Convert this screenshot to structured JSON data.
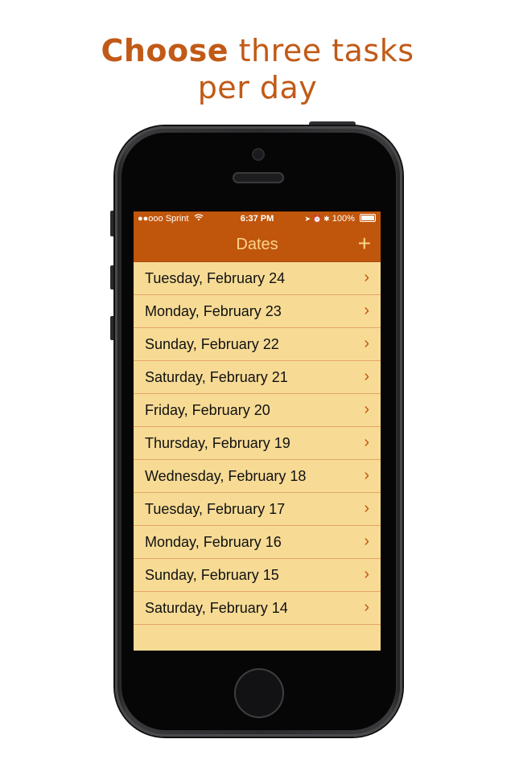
{
  "headline": {
    "bold": "Choose",
    "line1_rest": " three tasks",
    "line2": "per day"
  },
  "status_bar": {
    "carrier": "●●ooo Sprint",
    "wifi_icon": "wifi-icon",
    "time": "6:37 PM",
    "icons": "➤ ⏰ ✱",
    "battery": "100%"
  },
  "nav": {
    "title": "Dates",
    "add_label": "+"
  },
  "dates": [
    {
      "label": "Tuesday, February 24",
      "chevron": "›"
    },
    {
      "label": "Monday, February 23",
      "chevron": "›"
    },
    {
      "label": "Sunday, February 22",
      "chevron": "›"
    },
    {
      "label": "Saturday, February 21",
      "chevron": "›"
    },
    {
      "label": "Friday, February 20",
      "chevron": "›"
    },
    {
      "label": "Thursday, February 19",
      "chevron": "›"
    },
    {
      "label": "Wednesday, February 18",
      "chevron": "›"
    },
    {
      "label": "Tuesday, February 17",
      "chevron": "›"
    },
    {
      "label": "Monday, February 16",
      "chevron": "›"
    },
    {
      "label": "Sunday, February 15",
      "chevron": "›"
    },
    {
      "label": "Saturday, February 14",
      "chevron": "›"
    }
  ],
  "colors": {
    "accent": "#c15a17",
    "navbar": "#c0560c",
    "list_bg": "#f7db95",
    "separator": "#e4a566"
  }
}
